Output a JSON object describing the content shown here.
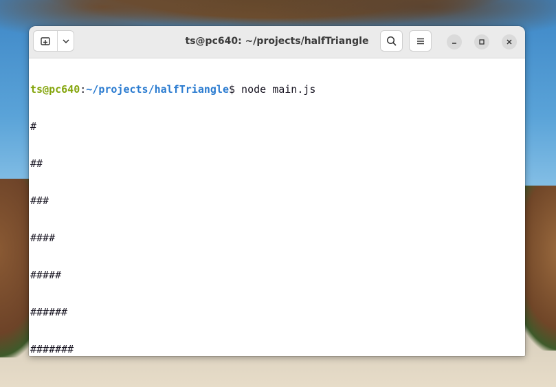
{
  "window": {
    "title": "ts@pc640: ~/projects/halfTriangle"
  },
  "titlebar": {
    "new_tab_icon": "new-tab-icon",
    "dropdown_icon": "chevron-down-icon",
    "search_icon": "search-icon",
    "menu_icon": "hamburger-menu-icon",
    "minimize_icon": "minimize-icon",
    "maximize_icon": "maximize-icon",
    "close_icon": "close-icon"
  },
  "terminal": {
    "prompt": {
      "user_host": "ts@pc640",
      "separator": ":",
      "path": "~/projects/halfTriangle",
      "symbol": "$"
    },
    "command": " node main.js",
    "output": [
      "#",
      "##",
      "###",
      "####",
      "#####",
      "######",
      "#######"
    ],
    "cursor_color": "#2a7bd0"
  },
  "colors": {
    "prompt_user": "#84a50c",
    "prompt_path": "#2a7bd0",
    "text": "#171421",
    "background": "#ffffff"
  }
}
